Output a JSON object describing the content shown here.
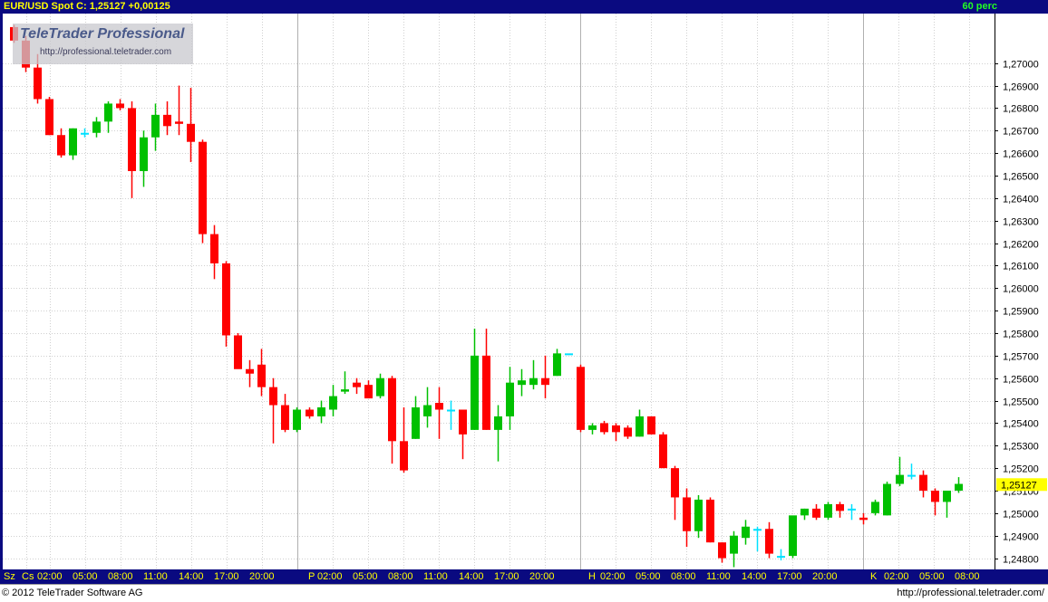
{
  "header": {
    "symbol_text": "EUR/USD  Spot  C: 1,25127  +0,00125",
    "period": "60 perc"
  },
  "watermark": {
    "brand": "TeleTrader Professional",
    "url": "http://professional.teletrader.com"
  },
  "footer": {
    "copyright": "© 2012 TeleTrader Software AG",
    "url": "http://professional.teletrader.com/"
  },
  "colors": {
    "up": "#00c000",
    "down": "#ff0000",
    "neutral": "#00e0ff",
    "grid": "#d0d0d0",
    "bar_bg": "#0a0a80",
    "axis_text": "#ffff00",
    "last_price_bg": "#ffff00"
  },
  "chart_data": {
    "type": "candlestick",
    "title": "EUR/USD Spot",
    "period": "60 perc",
    "last_close": "1,25127",
    "change": "+0,00125",
    "y_ticks": [
      "1,24800",
      "1,24900",
      "1,25000",
      "1,25100",
      "1,25200",
      "1,25300",
      "1,25400",
      "1,25500",
      "1,25600",
      "1,25700",
      "1,25800",
      "1,25900",
      "1,26000",
      "1,26100",
      "1,26200",
      "1,26300",
      "1,26400",
      "1,26500",
      "1,26600",
      "1,26700",
      "1,26800",
      "1,26900",
      "1,27000"
    ],
    "ylim": [
      1.2475,
      1.2722
    ],
    "x_labels": [
      {
        "day": "Sz",
        "labels": [
          "Cs",
          "02:00",
          "05:00",
          "08:00",
          "11:00",
          "14:00",
          "17:00",
          "20:00"
        ]
      },
      {
        "day": "P",
        "labels": [
          "02:00",
          "05:00",
          "08:00",
          "11:00",
          "14:00",
          "17:00",
          "20:00"
        ]
      },
      {
        "day": "H",
        "labels": [
          "02:00",
          "05:00",
          "08:00",
          "11:00",
          "14:00",
          "17:00",
          "20:00"
        ]
      },
      {
        "day": "K",
        "labels": [
          "02:00",
          "05:00",
          "08:00"
        ]
      }
    ],
    "candles": [
      [
        1.2716,
        1.2717,
        1.2709,
        1.271
      ],
      [
        1.271,
        1.2712,
        1.2696,
        1.2698
      ],
      [
        1.2698,
        1.2704,
        1.2682,
        1.2684
      ],
      [
        1.2684,
        1.2685,
        1.2668,
        1.2668
      ],
      [
        1.2668,
        1.2671,
        1.2658,
        1.2659
      ],
      [
        1.2659,
        1.2671,
        1.2657,
        1.2671
      ],
      [
        1.2669,
        1.2671,
        1.2667,
        1.2669
      ],
      [
        1.2669,
        1.2676,
        1.2667,
        1.2674
      ],
      [
        1.2674,
        1.2683,
        1.2669,
        1.2682
      ],
      [
        1.2682,
        1.2684,
        1.2679,
        1.268
      ],
      [
        1.268,
        1.2683,
        1.264,
        1.2652
      ],
      [
        1.2652,
        1.267,
        1.2645,
        1.2667
      ],
      [
        1.2667,
        1.2682,
        1.2661,
        1.2677
      ],
      [
        1.2677,
        1.2683,
        1.2668,
        1.2672
      ],
      [
        1.2674,
        1.269,
        1.2668,
        1.2673
      ],
      [
        1.2673,
        1.2689,
        1.2656,
        1.2665
      ],
      [
        1.2665,
        1.2666,
        1.262,
        1.2624
      ],
      [
        1.2624,
        1.2628,
        1.2604,
        1.2611
      ],
      [
        1.2611,
        1.2612,
        1.2574,
        1.2579
      ],
      [
        1.2579,
        1.258,
        1.2565,
        1.2564
      ],
      [
        1.2564,
        1.2568,
        1.2556,
        1.2562
      ],
      [
        1.2566,
        1.2573,
        1.2552,
        1.2556
      ],
      [
        1.2556,
        1.256,
        1.2531,
        1.2548
      ],
      [
        1.2548,
        1.2553,
        1.2536,
        1.2537
      ],
      [
        1.2537,
        1.2547,
        1.2536,
        1.2546
      ],
      [
        1.2546,
        1.2547,
        1.2542,
        1.2543
      ],
      [
        1.2543,
        1.255,
        1.254,
        1.2547
      ],
      [
        1.2546,
        1.2557,
        1.2543,
        1.2552
      ],
      [
        1.2554,
        1.2563,
        1.2553,
        1.2555
      ],
      [
        1.2558,
        1.256,
        1.2553,
        1.2556
      ],
      [
        1.2557,
        1.2559,
        1.2551,
        1.2551
      ],
      [
        1.2552,
        1.2562,
        1.2551,
        1.256
      ],
      [
        1.256,
        1.2561,
        1.2522,
        1.2532
      ],
      [
        1.2532,
        1.2547,
        1.2518,
        1.2519
      ],
      [
        1.2533,
        1.2552,
        1.2533,
        1.2547
      ],
      [
        1.2543,
        1.2556,
        1.2538,
        1.2548
      ],
      [
        1.2549,
        1.2556,
        1.2533,
        1.2546
      ],
      [
        1.2546,
        1.255,
        1.2537,
        1.2546
      ],
      [
        1.2546,
        1.2546,
        1.2524,
        1.2535
      ],
      [
        1.2537,
        1.2582,
        1.2537,
        1.257
      ],
      [
        1.257,
        1.2582,
        1.2537,
        1.2537
      ],
      [
        1.2537,
        1.2548,
        1.2523,
        1.2543
      ],
      [
        1.2543,
        1.2565,
        1.2537,
        1.2558
      ],
      [
        1.2557,
        1.2564,
        1.2552,
        1.2559
      ],
      [
        1.2557,
        1.2568,
        1.2555,
        1.256
      ],
      [
        1.256,
        1.257,
        1.2551,
        1.2557
      ],
      [
        1.2561,
        1.2573,
        1.2561,
        1.2571
      ],
      [
        1.2571,
        1.2571,
        1.2571,
        1.2571
      ],
      [
        1.2565,
        1.2566,
        1.2536,
        1.2537
      ],
      [
        1.2537,
        1.254,
        1.2535,
        1.2539
      ],
      [
        1.254,
        1.2541,
        1.2535,
        1.2536
      ],
      [
        1.2539,
        1.254,
        1.2532,
        1.2536
      ],
      [
        1.2538,
        1.2539,
        1.2533,
        1.2534
      ],
      [
        1.2534,
        1.2546,
        1.2534,
        1.2543
      ],
      [
        1.2543,
        1.2543,
        1.2535,
        1.2535
      ],
      [
        1.2535,
        1.2536,
        1.252,
        1.252
      ],
      [
        1.252,
        1.2521,
        1.2497,
        1.2507
      ],
      [
        1.2507,
        1.2511,
        1.2485,
        1.2492
      ],
      [
        1.2492,
        1.2508,
        1.2489,
        1.2506
      ],
      [
        1.2506,
        1.2507,
        1.2487,
        1.2487
      ],
      [
        1.2487,
        1.2487,
        1.2478,
        1.248
      ],
      [
        1.2482,
        1.2492,
        1.2476,
        1.249
      ],
      [
        1.2489,
        1.2497,
        1.2486,
        1.2494
      ],
      [
        1.2493,
        1.2494,
        1.2483,
        1.2493
      ],
      [
        1.2493,
        1.2496,
        1.248,
        1.2482
      ],
      [
        1.2481,
        1.2484,
        1.2479,
        1.2481
      ],
      [
        1.2481,
        1.2498,
        1.248,
        1.2499
      ],
      [
        1.2499,
        1.2502,
        1.2497,
        1.2502
      ],
      [
        1.2502,
        1.2504,
        1.2497,
        1.2498
      ],
      [
        1.2498,
        1.2505,
        1.2497,
        1.2504
      ],
      [
        1.2504,
        1.2505,
        1.2498,
        1.2501
      ],
      [
        1.2502,
        1.2504,
        1.2497,
        1.2502
      ],
      [
        1.2498,
        1.25,
        1.2495,
        1.2497
      ],
      [
        1.25,
        1.2506,
        1.2499,
        1.2505
      ],
      [
        1.2499,
        1.2514,
        1.2499,
        1.2513
      ],
      [
        1.2513,
        1.2525,
        1.2512,
        1.2517
      ],
      [
        1.2517,
        1.2522,
        1.2515,
        1.2517
      ],
      [
        1.2517,
        1.2519,
        1.2507,
        1.251
      ],
      [
        1.251,
        1.2511,
        1.2499,
        1.2505
      ],
      [
        1.2505,
        1.251,
        1.2498,
        1.251
      ],
      [
        1.251,
        1.2516,
        1.2509,
        1.2513
      ]
    ]
  }
}
